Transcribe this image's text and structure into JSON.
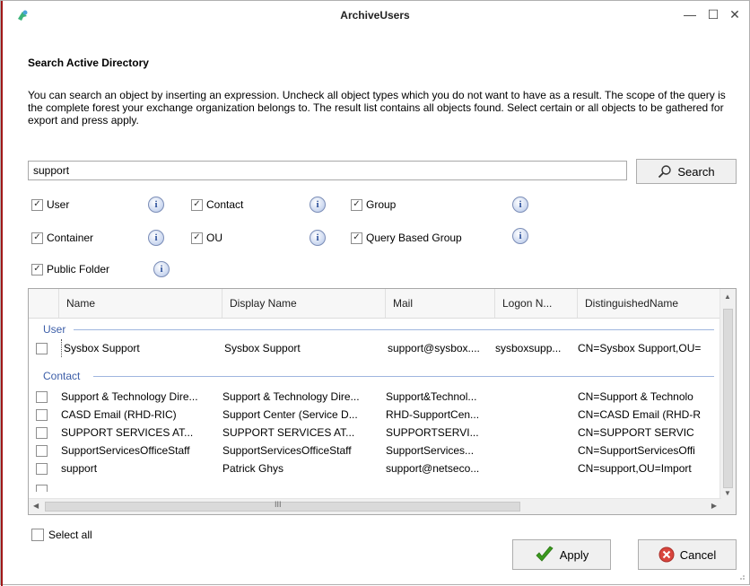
{
  "window": {
    "title": "ArchiveUsers",
    "minimize_glyph": "—",
    "maximize_glyph": "☐",
    "close_glyph": "✕"
  },
  "heading": "Search Active Directory",
  "description": "You can search an object by inserting an expression. Uncheck all object types which you do not want to have as a result. The scope of the query is the complete forest your exchange organization belongs to. The result list contains all objects found. Select certain or all objects to be gathered for export and press apply.",
  "search": {
    "value": "support",
    "button_label": "Search",
    "icon": "magnifier-icon"
  },
  "object_types": [
    {
      "label": "User",
      "checked": true
    },
    {
      "label": "Contact",
      "checked": true
    },
    {
      "label": "Group",
      "checked": true
    },
    {
      "label": "Container",
      "checked": true
    },
    {
      "label": "OU",
      "checked": true
    },
    {
      "label": "Query Based Group",
      "checked": true
    },
    {
      "label": "Public Folder",
      "checked": true
    }
  ],
  "grid": {
    "columns": [
      "Name",
      "Display Name",
      "Mail",
      "Logon N...",
      "DistinguishedName"
    ],
    "groups": [
      {
        "label": "User",
        "rows": [
          {
            "name": "Sysbox Support",
            "display": "Sysbox Support",
            "mail": "support@sysbox....",
            "logon": "sysboxsupp...",
            "dn": "CN=Sysbox Support,OU="
          }
        ]
      },
      {
        "label": "Contact",
        "rows": [
          {
            "name": "Support & Technology Dire...",
            "display": "Support & Technology Dire...",
            "mail": "Support&Technol...",
            "logon": "",
            "dn": "CN=Support & Technolo"
          },
          {
            "name": "CASD Email (RHD-RIC)",
            "display": "Support Center (Service D...",
            "mail": "RHD-SupportCen...",
            "logon": "",
            "dn": "CN=CASD Email (RHD-R"
          },
          {
            "name": "SUPPORT SERVICES AT...",
            "display": "SUPPORT SERVICES AT...",
            "mail": "SUPPORTSERVI...",
            "logon": "",
            "dn": "CN=SUPPORT SERVIC"
          },
          {
            "name": "SupportServicesOfficeStaff",
            "display": "SupportServicesOfficeStaff",
            "mail": "SupportServices...",
            "logon": "",
            "dn": "CN=SupportServicesOffi"
          },
          {
            "name": "support",
            "display": "Patrick Ghys",
            "mail": "support@netseco...",
            "logon": "",
            "dn": "CN=support,OU=Import"
          }
        ]
      }
    ],
    "hscroll_marker": "III"
  },
  "select_all_label": "Select all",
  "buttons": {
    "apply": "Apply",
    "cancel": "Cancel"
  },
  "colors": {
    "accent_red": "#a01818",
    "group_blue": "#3c5ea8",
    "apply_green": "#3a9a1e",
    "cancel_red": "#d9453d"
  }
}
